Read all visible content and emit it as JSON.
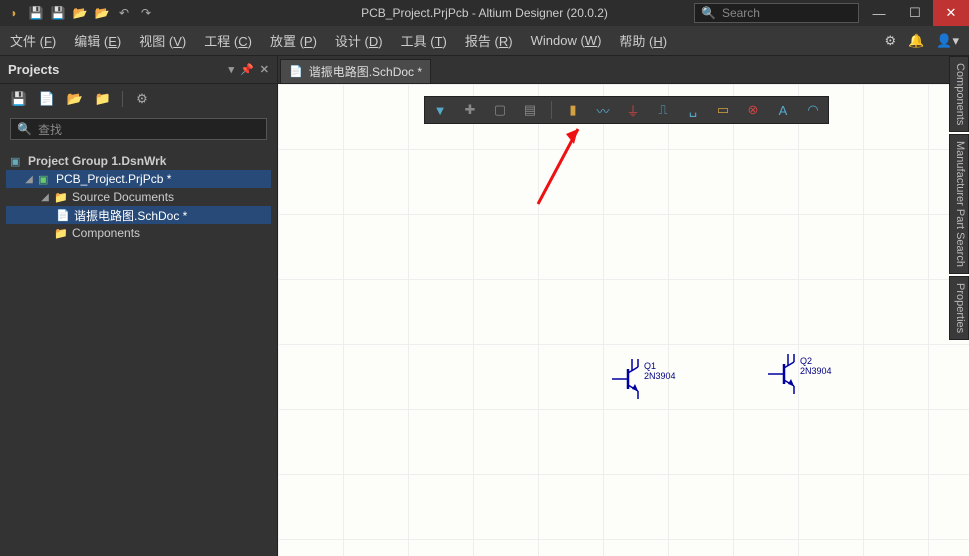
{
  "app": {
    "title": "PCB_Project.PrjPcb - Altium Designer (20.0.2)"
  },
  "titlebar_search": {
    "placeholder": "Search"
  },
  "menu": {
    "file": "文件",
    "file_u": "F",
    "edit": "编辑",
    "edit_u": "E",
    "view": "视图",
    "view_u": "V",
    "project": "工程",
    "project_u": "C",
    "place": "放置",
    "place_u": "P",
    "design": "设计",
    "design_u": "D",
    "tools": "工具",
    "tools_u": "T",
    "report": "报告",
    "report_u": "R",
    "window": "Window",
    "window_u": "W",
    "help": "帮助",
    "help_u": "H"
  },
  "projects_panel": {
    "title": "Projects",
    "search_placeholder": "查找"
  },
  "tree": {
    "root": "Project Group 1.DsnWrk",
    "project": "PCB_Project.PrjPcb *",
    "folder1": "Source Documents",
    "doc1": "谐振电路图.SchDoc *",
    "folder2": "Components"
  },
  "active_doc": {
    "label": "谐振电路图.SchDoc *"
  },
  "components": {
    "q1": {
      "ref": "Q1",
      "part": "2N3904"
    },
    "q2": {
      "ref": "Q2",
      "part": "2N3904"
    }
  },
  "right_panels": {
    "components": "Components",
    "mfr": "Manufacturer Part Search",
    "props": "Properties"
  },
  "colors": {
    "accent": "#274a78",
    "close": "#c03333",
    "wire": "#0000a0"
  }
}
